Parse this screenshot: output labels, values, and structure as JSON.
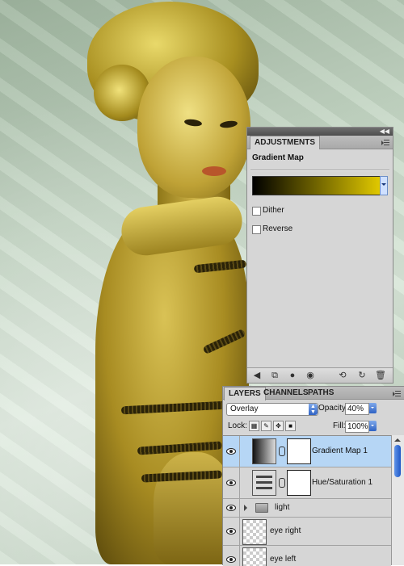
{
  "adjustments": {
    "tab": "ADJUSTMENTS",
    "title": "Gradient Map",
    "dither_label": "Dither",
    "reverse_label": "Reverse",
    "gradient_colors": [
      "#000000",
      "#e0c800"
    ]
  },
  "layers_panel": {
    "tabs": [
      "LAYERS",
      "CHANNELS",
      "PATHS"
    ],
    "blend_mode": "Overlay",
    "opacity_label": "Opacity:",
    "opacity_value": "40%",
    "lock_label": "Lock:",
    "fill_label": "Fill:",
    "fill_value": "100%",
    "layers": [
      {
        "name": "Gradient Map 1",
        "type": "gradient-map",
        "selected": true
      },
      {
        "name": "Hue/Saturation 1",
        "type": "hue-saturation",
        "selected": false
      },
      {
        "name": "light",
        "type": "group",
        "selected": false
      },
      {
        "name": "eye right",
        "type": "pixel",
        "selected": false
      },
      {
        "name": "eye left",
        "type": "pixel",
        "selected": false
      }
    ]
  },
  "colors": {
    "selection": "#b6d6f5",
    "accent": "#2f63c4",
    "panel": "#d6d6d6"
  }
}
